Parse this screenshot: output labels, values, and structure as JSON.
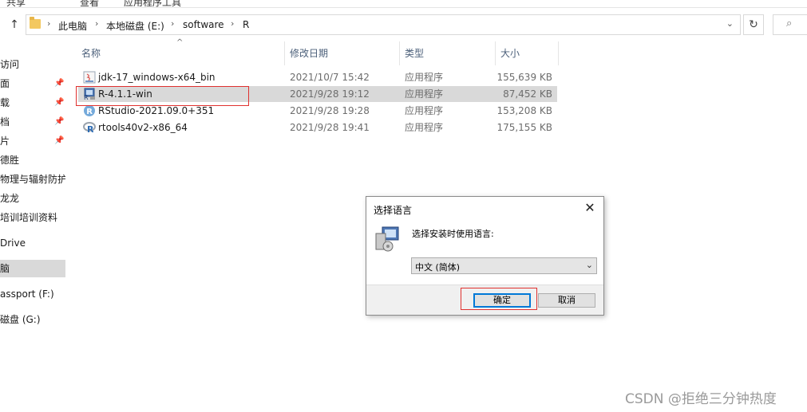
{
  "ribbon": {
    "fragments": [
      "共享",
      "查看",
      "应用程序工具"
    ]
  },
  "address_bar": {
    "crumbs": [
      "此电脑",
      "本地磁盘 (E:)",
      "software",
      "R"
    ]
  },
  "nav_pane": {
    "items": [
      {
        "label": "访问",
        "pinned": false
      },
      {
        "label": "面",
        "pinned": true
      },
      {
        "label": "载",
        "pinned": true
      },
      {
        "label": "档",
        "pinned": true
      },
      {
        "label": "片",
        "pinned": true
      },
      {
        "label": "德胜",
        "pinned": false
      },
      {
        "label": "物理与辐射防护",
        "pinned": false
      },
      {
        "label": "龙龙",
        "pinned": false
      },
      {
        "label": "培训培训资料",
        "pinned": false
      },
      {
        "label": "Drive",
        "pinned": false
      },
      {
        "label": "脑",
        "pinned": false
      },
      {
        "label": "assport (F:)",
        "pinned": false
      },
      {
        "label": "磁盘 (G:)",
        "pinned": false
      }
    ]
  },
  "file_list": {
    "columns": [
      "名称",
      "修改日期",
      "类型",
      "大小"
    ],
    "rows": [
      {
        "name": "jdk-17_windows-x64_bin",
        "date": "2021/10/7 15:42",
        "type": "应用程序",
        "size": "155,639 KB",
        "icon": "java-installer-icon"
      },
      {
        "name": "R-4.1.1-win",
        "date": "2021/9/28 19:12",
        "type": "应用程序",
        "size": "87,452 KB",
        "icon": "r-installer-icon"
      },
      {
        "name": "RStudio-2021.09.0+351",
        "date": "2021/9/28 19:28",
        "type": "应用程序",
        "size": "153,208 KB",
        "icon": "rstudio-icon"
      },
      {
        "name": "rtools40v2-x86_64",
        "date": "2021/9/28 19:41",
        "type": "应用程序",
        "size": "175,155 KB",
        "icon": "r-logo-icon"
      }
    ]
  },
  "dialog": {
    "title": "选择语言",
    "prompt": "选择安装时使用语言:",
    "selected_language": "中文 (简体)",
    "ok_label": "确定",
    "cancel_label": "取消"
  },
  "watermark": "CSDN @拒绝三分钟热度",
  "colors": {
    "highlight_box": "#e0312f",
    "selected_row": "#d9d9d9",
    "ok_focus": "#0078d7"
  }
}
